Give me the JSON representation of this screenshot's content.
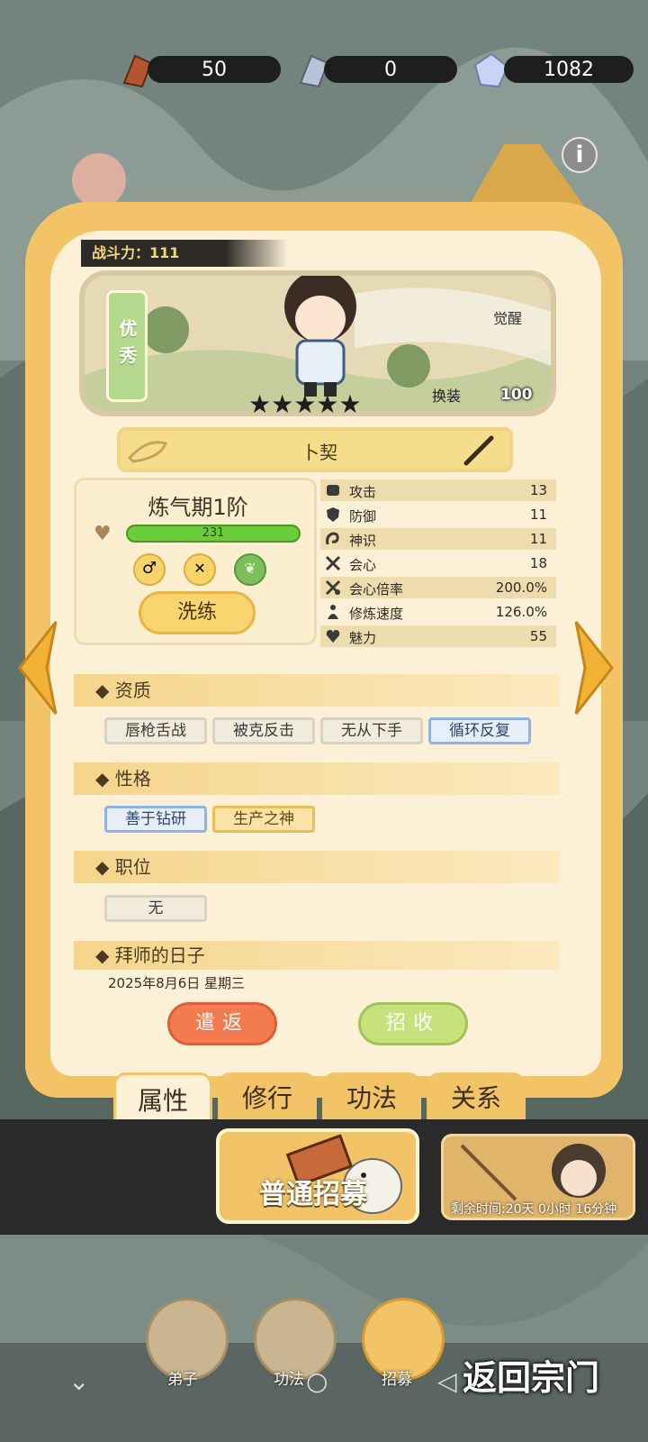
{
  "resources": [
    {
      "name": "copper-token",
      "value": "50"
    },
    {
      "name": "silver-token",
      "value": "0"
    },
    {
      "name": "spirit-stone",
      "value": "1082"
    }
  ],
  "disciple": {
    "power_label": "战斗力：111",
    "quality": "优秀",
    "stars": "★★★★★",
    "awaken": "觉醒",
    "swap": "换装",
    "level_badge": "100",
    "name": "卜契",
    "realm": "炼气期1阶",
    "hp": "231"
  },
  "stats": [
    {
      "label": "攻击",
      "value": "13"
    },
    {
      "label": "防御",
      "value": "11"
    },
    {
      "label": "神识",
      "value": "11"
    },
    {
      "label": "会心",
      "value": "18"
    },
    {
      "label": "会心倍率",
      "value": "200.0%"
    },
    {
      "label": "修炼速度",
      "value": "126.0%"
    },
    {
      "label": "魅力",
      "value": "55"
    }
  ],
  "wash_button": "洗练",
  "sections": {
    "aptitude": "◆ 资质",
    "personality": "◆ 性格",
    "position": "◆ 职位",
    "apprentice_day": "◆ 拜师的日子"
  },
  "aptitude_tags": [
    "唇枪舌战",
    "被克反击",
    "无从下手",
    "循环反复"
  ],
  "personality_tags": [
    "善于钻研",
    "生产之神"
  ],
  "position_tag": "无",
  "apprentice_date": "2025年8月6日 星期三",
  "actions": {
    "dismiss": "遣返",
    "recruit": "招收"
  },
  "tabs": [
    "属性",
    "修行",
    "功法",
    "关系"
  ],
  "normal_recruit": "普通招募",
  "event_timer": "剩余时间:20天 0小时 16分钟",
  "nav": [
    "弟子",
    "功法",
    "招募"
  ],
  "return_label": "返回宗门",
  "colors": {
    "card": "#f2c467",
    "card_inner": "#fcf1d6",
    "hp": "#6ccd3a",
    "dismiss": "#f47b4f",
    "recruit": "#c5e27c"
  }
}
